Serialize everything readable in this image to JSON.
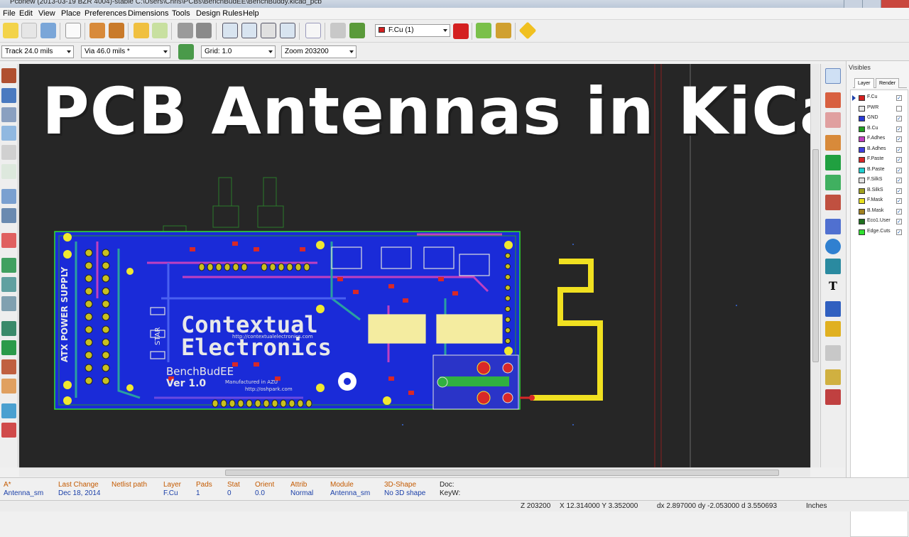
{
  "window": {
    "title": "Pcbnew (2013-03-19 BZR 4004)-stable C:\\Users\\Chris\\PCBs\\BenchBudEE\\BenchBuddy.kicad_pcb"
  },
  "menu": [
    "File",
    "Edit",
    "View",
    "Place",
    "Preferences",
    "Dimensions",
    "Tools",
    "Design Rules",
    "Help"
  ],
  "toolbar": {
    "layer_select": "F.Cu (1)",
    "layer_color": "#d42020",
    "track_width": "Track 24.0 mils",
    "via_size": "Via 46.0 mils *",
    "grid": "Grid: 1.0",
    "zoom": "Zoom 203200"
  },
  "overlay": {
    "title": "PCB Antennas in KiCad"
  },
  "board": {
    "silk_text_1": "Contextual",
    "silk_text_2": "Electronics",
    "silk_name": "BenchBudEE",
    "silk_version": "Ver 1.0",
    "silk_side": "ATX POWER SUPPLY",
    "silk_star": "STAR",
    "silk_url": "http://contextualelectronics.com",
    "silk_url2": "http://oshpark.com",
    "silk_manufactured": "Manufactured in AZU"
  },
  "layers_panel": {
    "title": "Visibles",
    "tabs": [
      "Layer",
      "Render"
    ],
    "items": [
      {
        "name": "F.Cu",
        "color": "#d42020",
        "checked": true
      },
      {
        "name": "PWR",
        "color": "#e8e8e8",
        "checked": false
      },
      {
        "name": "GND",
        "color": "#2a3bd6",
        "checked": true
      },
      {
        "name": "B.Cu",
        "color": "#22a022",
        "checked": true
      },
      {
        "name": "F.Adhes",
        "color": "#c040c0",
        "checked": true
      },
      {
        "name": "B.Adhes",
        "color": "#4040e0",
        "checked": true
      },
      {
        "name": "F.Paste",
        "color": "#d82828",
        "checked": true
      },
      {
        "name": "B.Paste",
        "color": "#20d0d0",
        "checked": true
      },
      {
        "name": "F.SilkS",
        "color": "#e0e0e0",
        "checked": true
      },
      {
        "name": "B.SilkS",
        "color": "#a0a020",
        "checked": true
      },
      {
        "name": "F.Mask",
        "color": "#e8e020",
        "checked": true
      },
      {
        "name": "B.Mask",
        "color": "#a08020",
        "checked": true
      },
      {
        "name": "Eco1.User",
        "color": "#207020",
        "checked": true
      },
      {
        "name": "Edge.Cuts",
        "color": "#30e030",
        "checked": true
      }
    ]
  },
  "message_panel": {
    "fields": [
      {
        "label": "A*",
        "value": "Antenna_sm"
      },
      {
        "label": "Last Change",
        "value": "Dec 18, 2014"
      },
      {
        "label": "Netlist path",
        "value": ""
      },
      {
        "label": "Layer",
        "value": "F.Cu"
      },
      {
        "label": "Pads",
        "value": "1"
      },
      {
        "label": "Stat",
        "value": "0"
      },
      {
        "label": "Orient",
        "value": "0.0"
      },
      {
        "label": "Attrib",
        "value": "Normal"
      },
      {
        "label": "Module",
        "value": "Antenna_sm"
      },
      {
        "label": "3D-Shape",
        "value": "No 3D shape"
      },
      {
        "label": "Doc:",
        "value": "KeyW:"
      }
    ]
  },
  "status": {
    "zoom": "Z 203200",
    "coords": "X 12.314000  Y 3.352000",
    "delta": "dx 2.897000  dy -2.053000  d 3.550693",
    "units": "Inches"
  }
}
